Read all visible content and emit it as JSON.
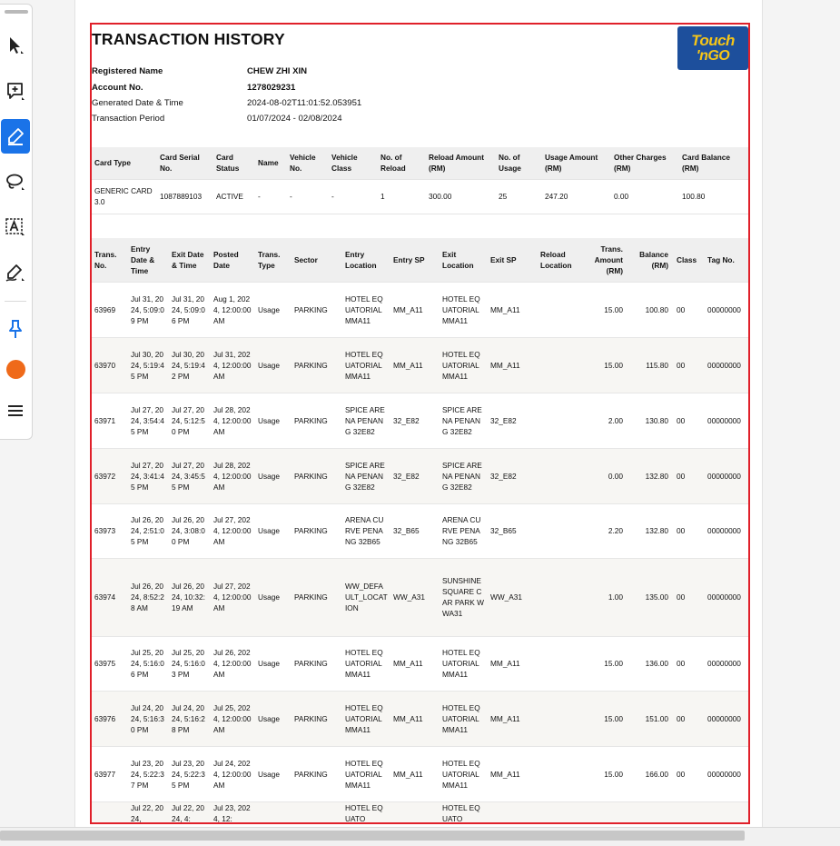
{
  "toolbar": {
    "tools": [
      {
        "icon": "cursor-arrow-icon"
      },
      {
        "icon": "add-comment-icon"
      },
      {
        "icon": "highlighter-icon",
        "active": true
      },
      {
        "icon": "lasso-icon"
      },
      {
        "icon": "text-box-icon"
      },
      {
        "icon": "sign-pen-icon"
      },
      {
        "icon": "pin-icon"
      },
      {
        "icon": "color-swatch-icon",
        "color": "#ef6a1a"
      },
      {
        "icon": "menu-lines-icon"
      }
    ],
    "accent": "#1a73e8"
  },
  "document": {
    "title": "TRANSACTION HISTORY",
    "logo": {
      "line1": "Touch",
      "line2": "'nGO"
    },
    "info": [
      {
        "label": "Registered Name",
        "value": "CHEW ZHI XIN"
      },
      {
        "label": "Account No.",
        "value": "1278029231"
      },
      {
        "label": "Generated Date & Time",
        "value": "2024-08-02T11:01:52.053951"
      },
      {
        "label": "Transaction Period",
        "value": "01/07/2024 - 02/08/2024"
      }
    ],
    "card_table": {
      "headers": [
        "Card Type",
        "Card Serial No.",
        "Card Status",
        "Name",
        "Vehicle No.",
        "Vehicle Class",
        "No. of Reload",
        "Reload Amount (RM)",
        "No. of Usage",
        "Usage Amount (RM)",
        "Other Charges (RM)",
        "Card Balance (RM)"
      ],
      "row": [
        "GENERIC CARD 3.0",
        "1087889103",
        "ACTIVE",
        "-",
        "-",
        "-",
        "1",
        "300.00",
        "25",
        "247.20",
        "0.00",
        "100.80"
      ]
    },
    "tx_table": {
      "headers": [
        "Trans. No.",
        "Entry Date & Time",
        "Exit Date & Time",
        "Posted Date",
        "Trans. Type",
        "Sector",
        "Entry Location",
        "Entry SP",
        "Exit Location",
        "Exit SP",
        "Reload Location",
        "Trans. Amount (RM)",
        "Balance (RM)",
        "Class",
        "Tag No."
      ],
      "rows": [
        [
          "63969",
          "Jul 31, 2024, 5:09:09 PM",
          "Jul 31, 2024, 5:09:06 PM",
          "Aug 1, 2024, 12:00:00 AM",
          "Usage",
          "PARKING",
          "HOTEL EQUATORIAL MMA11",
          "MM_A11",
          "HOTEL EQUATORIAL MMA11",
          "MM_A11",
          "",
          "15.00",
          "100.80",
          "00",
          "00000000"
        ],
        [
          "63970",
          "Jul 30, 2024, 5:19:45 PM",
          "Jul 30, 2024, 5:19:42 PM",
          "Jul 31, 2024, 12:00:00 AM",
          "Usage",
          "PARKING",
          "HOTEL EQUATORIAL MMA11",
          "MM_A11",
          "HOTEL EQUATORIAL MMA11",
          "MM_A11",
          "",
          "15.00",
          "115.80",
          "00",
          "00000000"
        ],
        [
          "63971",
          "Jul 27, 2024, 3:54:45 PM",
          "Jul 27, 2024, 5:12:50 PM",
          "Jul 28, 2024, 12:00:00 AM",
          "Usage",
          "PARKING",
          "SPICE ARENA PENANG 32E82",
          "32_E82",
          "SPICE ARENA PENANG 32E82",
          "32_E82",
          "",
          "2.00",
          "130.80",
          "00",
          "00000000"
        ],
        [
          "63972",
          "Jul 27, 2024, 3:41:45 PM",
          "Jul 27, 2024, 3:45:55 PM",
          "Jul 28, 2024, 12:00:00 AM",
          "Usage",
          "PARKING",
          "SPICE ARENA PENANG 32E82",
          "32_E82",
          "SPICE ARENA PENANG 32E82",
          "32_E82",
          "",
          "0.00",
          "132.80",
          "00",
          "00000000"
        ],
        [
          "63973",
          "Jul 26, 2024, 2:51:05 PM",
          "Jul 26, 2024, 3:08:00 PM",
          "Jul 27, 2024, 12:00:00 AM",
          "Usage",
          "PARKING",
          "ARENA CURVE PENANG 32B65",
          "32_B65",
          "ARENA CURVE PENANG 32B65",
          "32_B65",
          "",
          "2.20",
          "132.80",
          "00",
          "00000000"
        ],
        [
          "63974",
          "Jul 26, 2024, 8:52:28 AM",
          "Jul 26, 2024, 10:32:19 AM",
          "Jul 27, 2024, 12:00:00 AM",
          "Usage",
          "PARKING",
          "WW_DEFAULT_LOCATION",
          "WW_A31",
          "SUNSHINE SQUARE CAR PARK WWA31",
          "WW_A31",
          "",
          "1.00",
          "135.00",
          "00",
          "00000000"
        ],
        [
          "63975",
          "Jul 25, 2024, 5:16:06 PM",
          "Jul 25, 2024, 5:16:03 PM",
          "Jul 26, 2024, 12:00:00 AM",
          "Usage",
          "PARKING",
          "HOTEL EQUATORIAL MMA11",
          "MM_A11",
          "HOTEL EQUATORIAL MMA11",
          "MM_A11",
          "",
          "15.00",
          "136.00",
          "00",
          "00000000"
        ],
        [
          "63976",
          "Jul 24, 2024, 5:16:30 PM",
          "Jul 24, 2024, 5:16:28 PM",
          "Jul 25, 2024, 12:00:00 AM",
          "Usage",
          "PARKING",
          "HOTEL EQUATORIAL MMA11",
          "MM_A11",
          "HOTEL EQUATORIAL MMA11",
          "MM_A11",
          "",
          "15.00",
          "151.00",
          "00",
          "00000000"
        ],
        [
          "63977",
          "Jul 23, 2024, 5:22:37 PM",
          "Jul 23, 2024, 5:22:35 PM",
          "Jul 24, 2024, 12:00:00 AM",
          "Usage",
          "PARKING",
          "HOTEL EQUATORIAL MMA11",
          "MM_A11",
          "HOTEL EQUATORIAL MMA11",
          "MM_A11",
          "",
          "15.00",
          "166.00",
          "00",
          "00000000"
        ],
        [
          "",
          "Jul 22, 2024,",
          "Jul 22, 2024, 4:",
          "Jul 23, 2024, 12:",
          "",
          "",
          "HOTEL EQUATO",
          "",
          "HOTEL EQUATO",
          "",
          "",
          "",
          "",
          "",
          ""
        ]
      ]
    }
  }
}
